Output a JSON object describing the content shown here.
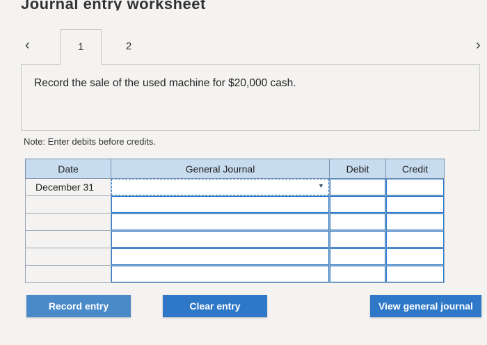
{
  "page": {
    "title": "Journal entry worksheet"
  },
  "nav": {
    "prev_icon": "‹",
    "next_icon": "›",
    "tabs": [
      {
        "label": "1",
        "active": true
      },
      {
        "label": "2",
        "active": false
      }
    ]
  },
  "prompt": {
    "text": "Record the sale of the used machine for $20,000 cash."
  },
  "note": {
    "text": "Note: Enter debits before credits."
  },
  "journal": {
    "headers": {
      "date": "Date",
      "account": "General Journal",
      "debit": "Debit",
      "credit": "Credit"
    },
    "rows": [
      {
        "date": "December 31",
        "account": "",
        "debit": "",
        "credit": ""
      },
      {
        "date": "",
        "account": "",
        "debit": "",
        "credit": ""
      },
      {
        "date": "",
        "account": "",
        "debit": "",
        "credit": ""
      },
      {
        "date": "",
        "account": "",
        "debit": "",
        "credit": ""
      },
      {
        "date": "",
        "account": "",
        "debit": "",
        "credit": ""
      },
      {
        "date": "",
        "account": "",
        "debit": "",
        "credit": ""
      }
    ]
  },
  "buttons": {
    "record": "Record entry",
    "clear": "Clear entry",
    "view": "View general journal"
  },
  "colors": {
    "header_bg": "#c8dcef",
    "button_bg": "#2e78c7",
    "field_border": "#2a7bd4"
  },
  "icons": {
    "dropdown": "dropdown-caret-icon",
    "prev": "chevron-left-icon",
    "next": "chevron-right-icon"
  }
}
